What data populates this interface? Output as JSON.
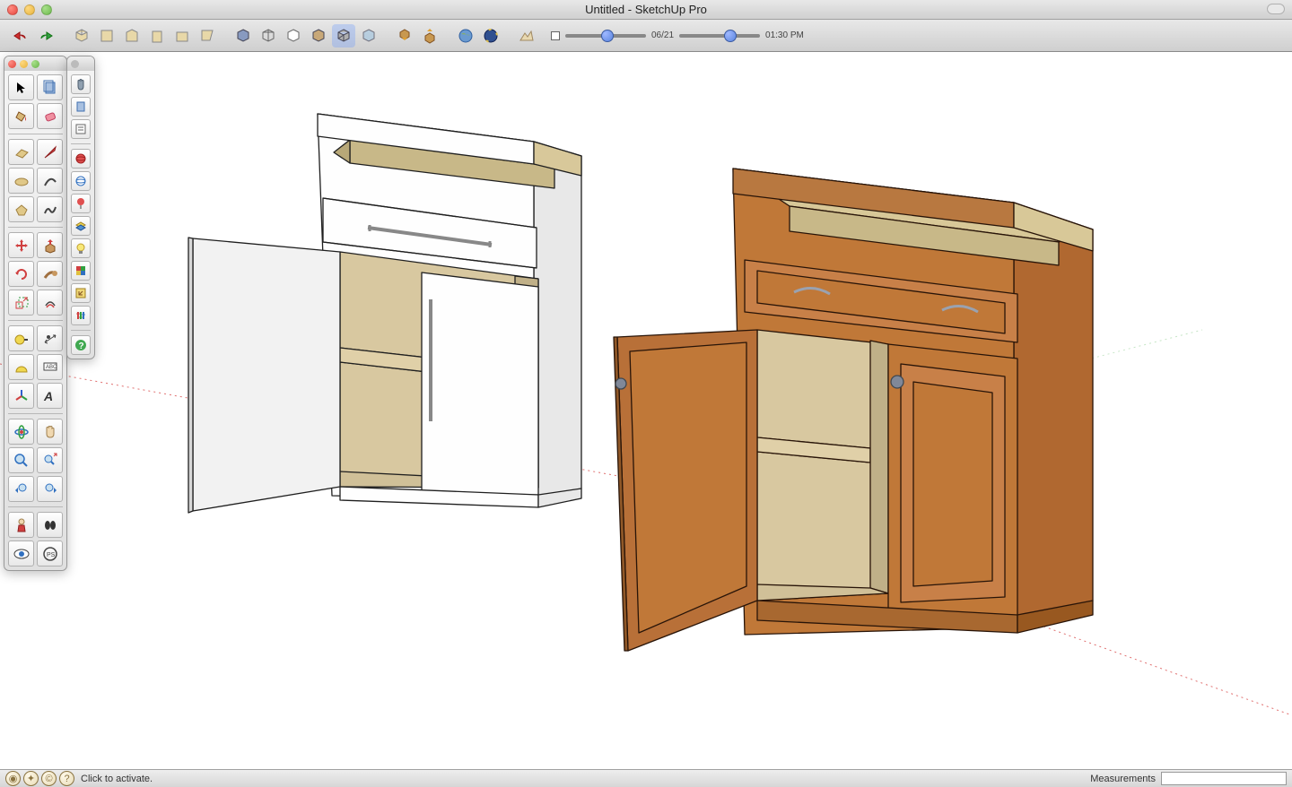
{
  "window": {
    "title": "Untitled - SketchUp Pro"
  },
  "top_toolbar": {
    "date_label": "06/21",
    "time_label": "01:30 PM"
  },
  "statusbar": {
    "hint": "Click to activate.",
    "measurements_label": "Measurements",
    "measurements_value": ""
  },
  "palette1_tools": [
    "select",
    "component",
    "paint",
    "eraser",
    "rectangle",
    "line",
    "circle",
    "arc",
    "polygon",
    "freehand",
    "move",
    "pushpull",
    "rotate",
    "followme",
    "scale",
    "offset",
    "tape",
    "dimension",
    "protractor",
    "text",
    "axes",
    "3dtext",
    "orbit",
    "pan",
    "zoom",
    "zoom-extents",
    "prev-view",
    "next-view",
    "position-camera",
    "walk",
    "look-around",
    "section"
  ],
  "palette2_tools": [
    "hand",
    "make-component",
    "outliner",
    "sphere-red",
    "sphere-blue",
    "pin-red",
    "layers",
    "lightbulb",
    "palette-icon",
    "resize",
    "sliders",
    "help"
  ]
}
